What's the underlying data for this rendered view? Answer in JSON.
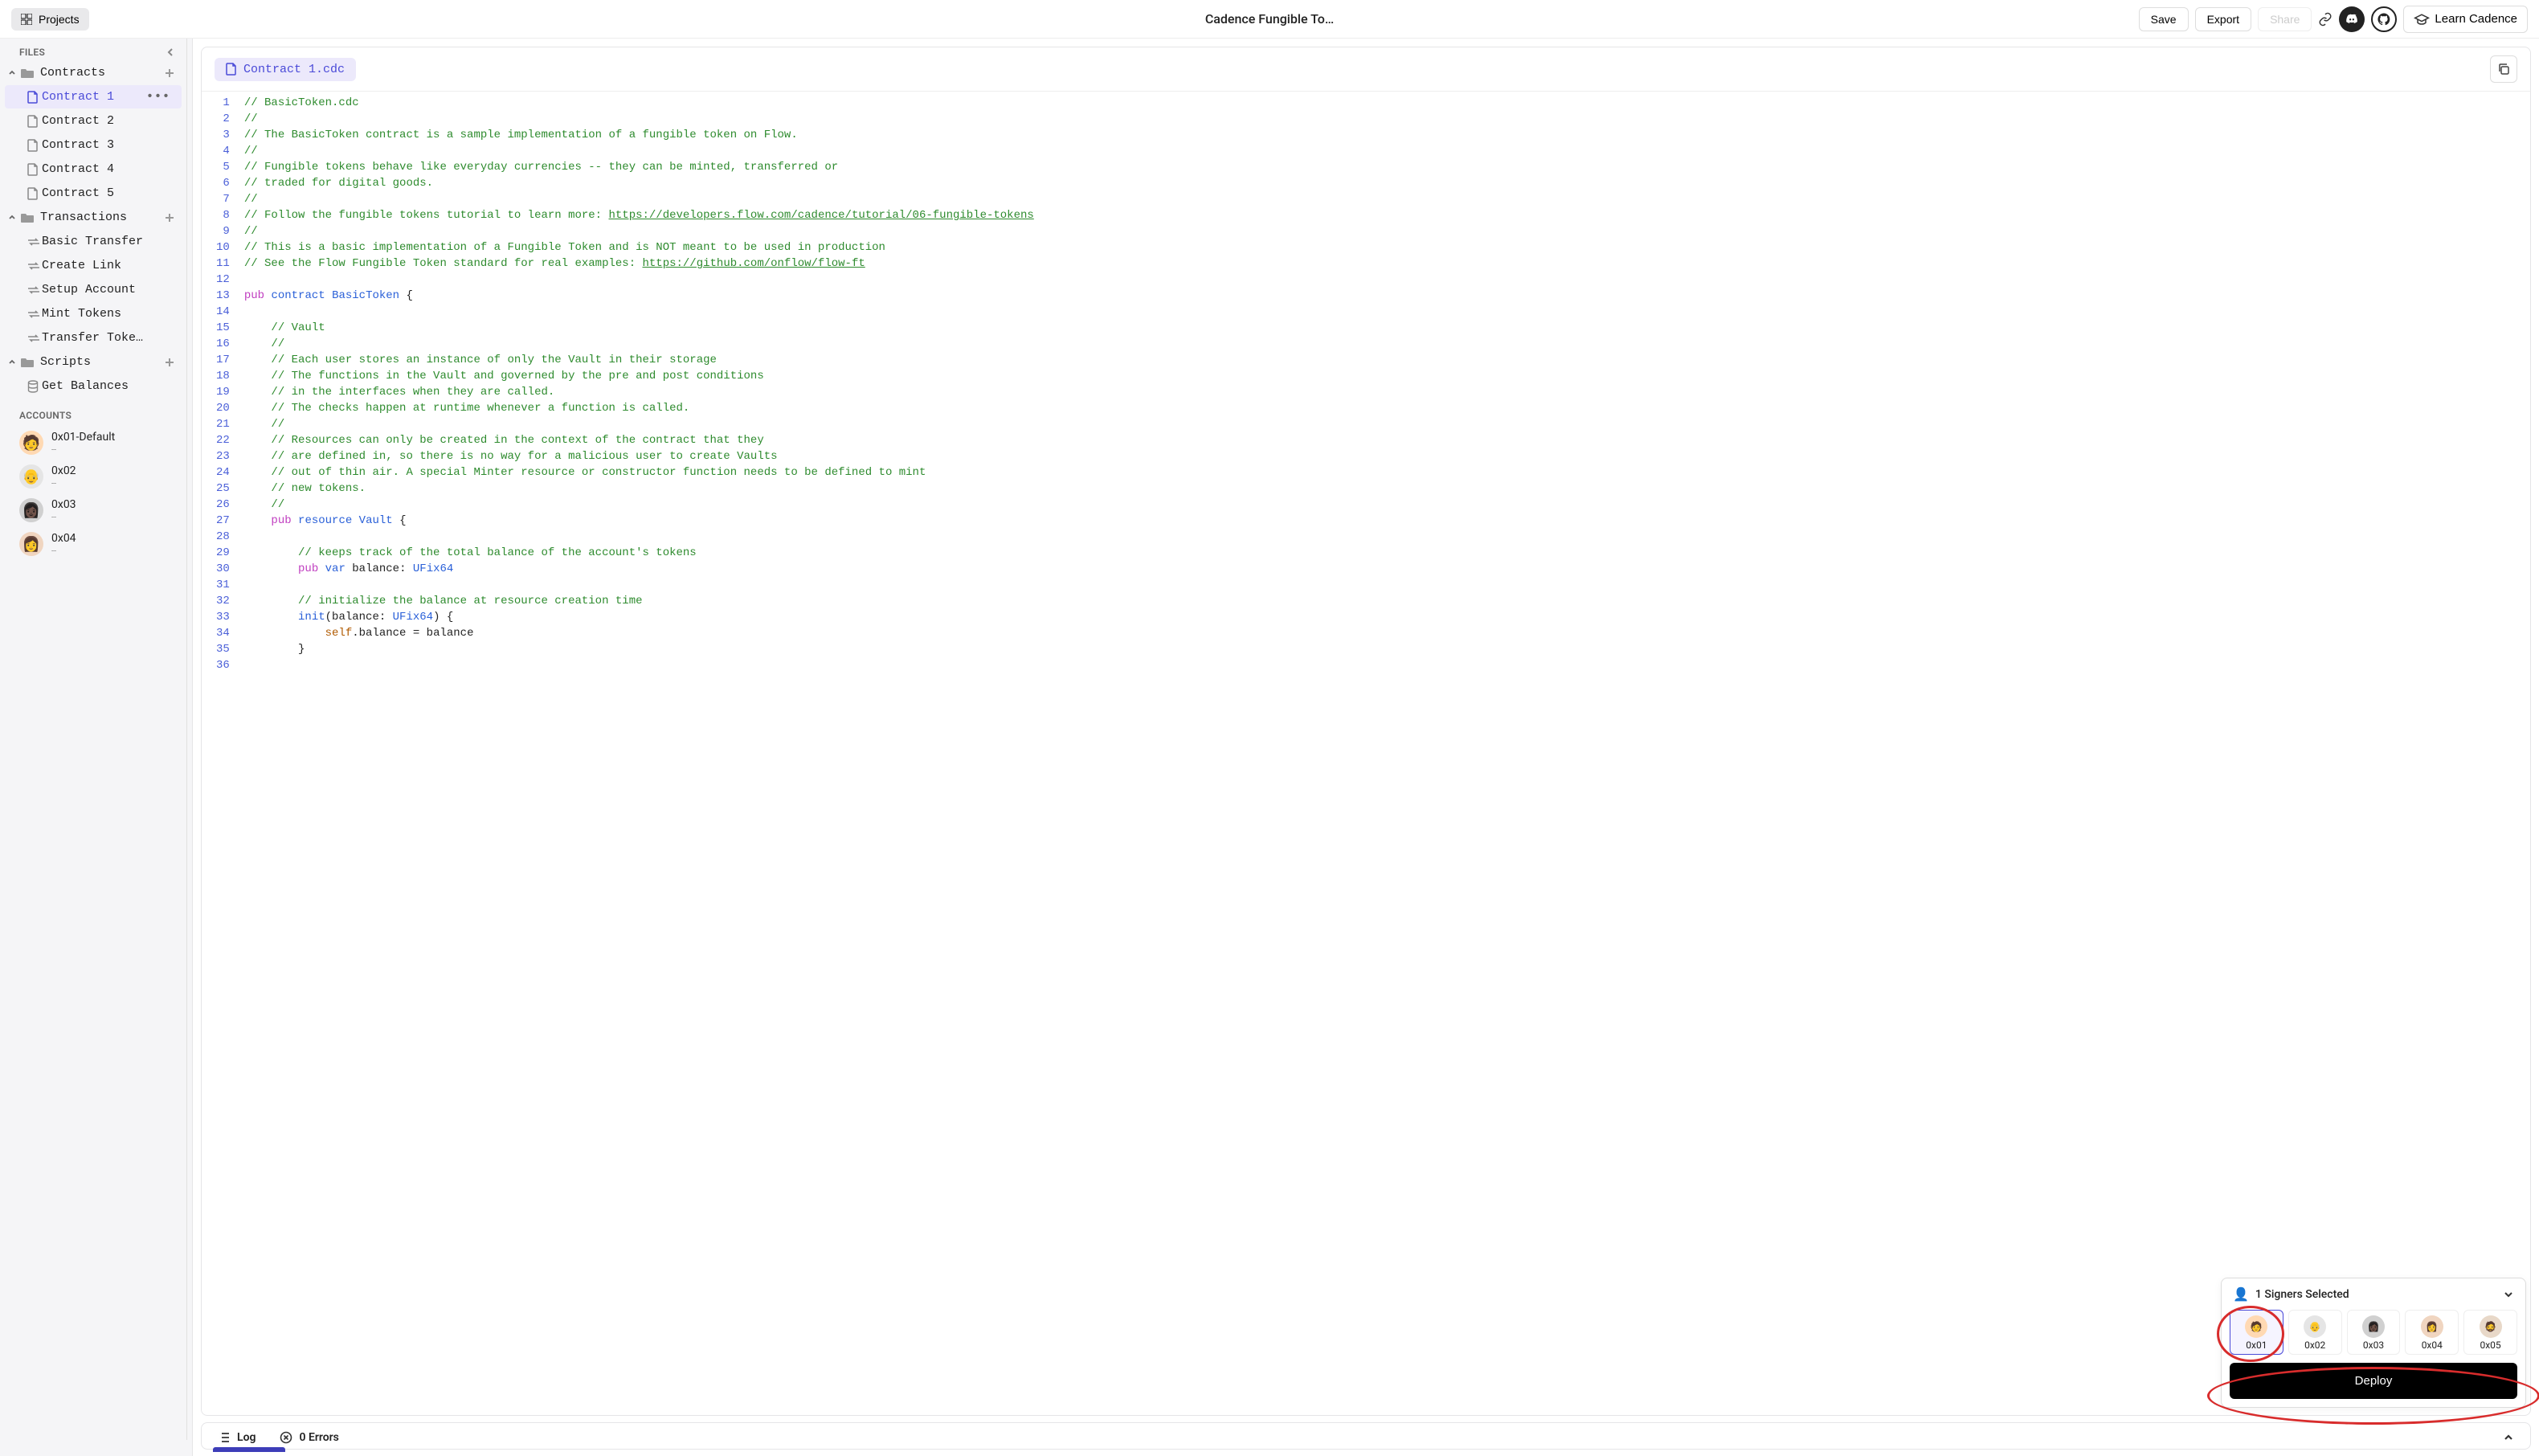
{
  "topbar": {
    "projects_label": "Projects",
    "title": "Cadence Fungible To…",
    "save_label": "Save",
    "export_label": "Export",
    "share_label": "Share",
    "learn_label": "Learn Cadence"
  },
  "sidebar": {
    "files_label": "FILES",
    "sections": {
      "contracts": {
        "label": "Contracts",
        "items": [
          "Contract 1",
          "Contract 2",
          "Contract 3",
          "Contract 4",
          "Contract 5"
        ],
        "active_index": 0
      },
      "transactions": {
        "label": "Transactions",
        "items": [
          "Basic Transfer",
          "Create Link",
          "Setup Account",
          "Mint Tokens",
          "Transfer Toke…"
        ]
      },
      "scripts": {
        "label": "Scripts",
        "items": [
          "Get Balances"
        ]
      }
    },
    "accounts_label": "ACCOUNTS",
    "accounts": [
      {
        "name": "0x01-Default",
        "sub": "--",
        "color": "av-orange"
      },
      {
        "name": "0x02",
        "sub": "--",
        "color": "av-gray"
      },
      {
        "name": "0x03",
        "sub": "--",
        "color": "av-dark"
      },
      {
        "name": "0x04",
        "sub": "--",
        "color": "av-brown"
      }
    ]
  },
  "tab": {
    "label": "Contract 1.cdc"
  },
  "code": {
    "lines": [
      [
        {
          "t": "// BasicToken.cdc",
          "c": "cm-comment"
        }
      ],
      [
        {
          "t": "//",
          "c": "cm-comment"
        }
      ],
      [
        {
          "t": "// The BasicToken contract is a sample implementation of a fungible token on Flow.",
          "c": "cm-comment"
        }
      ],
      [
        {
          "t": "//",
          "c": "cm-comment"
        }
      ],
      [
        {
          "t": "// Fungible tokens behave like everyday currencies -- they can be minted, transferred or",
          "c": "cm-comment"
        }
      ],
      [
        {
          "t": "// traded for digital goods.",
          "c": "cm-comment"
        }
      ],
      [
        {
          "t": "//",
          "c": "cm-comment"
        }
      ],
      [
        {
          "t": "// Follow the fungible tokens tutorial to learn more: ",
          "c": "cm-comment"
        },
        {
          "t": "https://developers.flow.com/cadence/tutorial/06-fungible-tokens",
          "c": "cm-link"
        }
      ],
      [
        {
          "t": "//",
          "c": "cm-comment"
        }
      ],
      [
        {
          "t": "// This is a basic implementation of a Fungible Token and is NOT meant to be used in production",
          "c": "cm-comment"
        }
      ],
      [
        {
          "t": "// See the Flow Fungible Token standard for real examples: ",
          "c": "cm-comment"
        },
        {
          "t": "https://github.com/onflow/flow-ft",
          "c": "cm-link"
        }
      ],
      [],
      [
        {
          "t": "pub",
          "c": "cm-kw"
        },
        {
          "t": " ",
          "c": ""
        },
        {
          "t": "contract",
          "c": "cm-kw2"
        },
        {
          "t": " ",
          "c": ""
        },
        {
          "t": "BasicToken",
          "c": "cm-type"
        },
        {
          "t": " {",
          "c": "cm-punct"
        }
      ],
      [],
      [
        {
          "t": "    // Vault",
          "c": "cm-comment"
        }
      ],
      [
        {
          "t": "    //",
          "c": "cm-comment"
        }
      ],
      [
        {
          "t": "    // Each user stores an instance of only the Vault in their storage",
          "c": "cm-comment"
        }
      ],
      [
        {
          "t": "    // The functions in the Vault and governed by the pre and post conditions",
          "c": "cm-comment"
        }
      ],
      [
        {
          "t": "    // in the interfaces when they are called.",
          "c": "cm-comment"
        }
      ],
      [
        {
          "t": "    // The checks happen at runtime whenever a function is called.",
          "c": "cm-comment"
        }
      ],
      [
        {
          "t": "    //",
          "c": "cm-comment"
        }
      ],
      [
        {
          "t": "    // Resources can only be created in the context of the contract that they",
          "c": "cm-comment"
        }
      ],
      [
        {
          "t": "    // are defined in, so there is no way for a malicious user to create Vaults",
          "c": "cm-comment"
        }
      ],
      [
        {
          "t": "    // out of thin air. A special Minter resource or constructor function needs to be defined to mint",
          "c": "cm-comment"
        }
      ],
      [
        {
          "t": "    // new tokens.",
          "c": "cm-comment"
        }
      ],
      [
        {
          "t": "    //",
          "c": "cm-comment"
        }
      ],
      [
        {
          "t": "    ",
          "c": ""
        },
        {
          "t": "pub",
          "c": "cm-kw"
        },
        {
          "t": " ",
          "c": ""
        },
        {
          "t": "resource",
          "c": "cm-kw2"
        },
        {
          "t": " ",
          "c": ""
        },
        {
          "t": "Vault",
          "c": "cm-type"
        },
        {
          "t": " {",
          "c": "cm-punct"
        }
      ],
      [],
      [
        {
          "t": "        // keeps track of the total balance of the account's tokens",
          "c": "cm-comment"
        }
      ],
      [
        {
          "t": "        ",
          "c": ""
        },
        {
          "t": "pub",
          "c": "cm-kw"
        },
        {
          "t": " ",
          "c": ""
        },
        {
          "t": "var",
          "c": "cm-kw2"
        },
        {
          "t": " balance: ",
          "c": "cm-ident"
        },
        {
          "t": "UFix64",
          "c": "cm-type"
        }
      ],
      [],
      [
        {
          "t": "        // initialize the balance at resource creation time",
          "c": "cm-comment"
        }
      ],
      [
        {
          "t": "        ",
          "c": ""
        },
        {
          "t": "init",
          "c": "cm-fn"
        },
        {
          "t": "(balance: ",
          "c": "cm-ident"
        },
        {
          "t": "UFix64",
          "c": "cm-type"
        },
        {
          "t": ") {",
          "c": "cm-punct"
        }
      ],
      [
        {
          "t": "            ",
          "c": ""
        },
        {
          "t": "self",
          "c": "cm-self"
        },
        {
          "t": ".balance = balance",
          "c": "cm-ident"
        }
      ],
      [
        {
          "t": "        }",
          "c": "cm-punct"
        }
      ],
      []
    ]
  },
  "bottom": {
    "log_label": "Log",
    "errors_label": "0 Errors"
  },
  "signer": {
    "header": "1 Signers Selected",
    "accounts": [
      {
        "label": "0x01",
        "color": "av-orange",
        "selected": true
      },
      {
        "label": "0x02",
        "color": "av-gray",
        "selected": false
      },
      {
        "label": "0x03",
        "color": "av-dark",
        "selected": false
      },
      {
        "label": "0x04",
        "color": "av-brown",
        "selected": false
      },
      {
        "label": "0x05",
        "color": "av-tan",
        "selected": false
      }
    ],
    "deploy_label": "Deploy"
  }
}
